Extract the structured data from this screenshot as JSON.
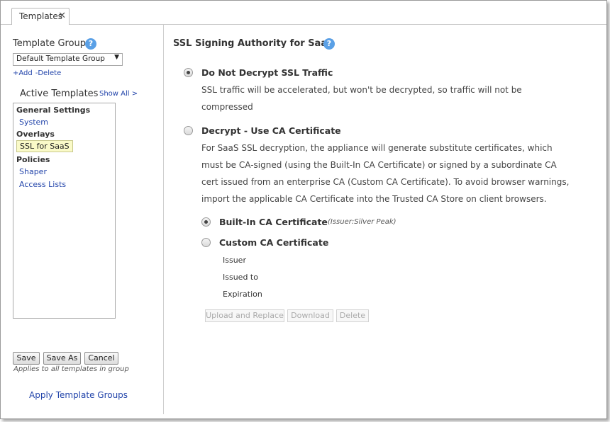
{
  "tab": {
    "title": "Templates",
    "close": "✕"
  },
  "sidebar": {
    "template_group_label": "Template Group",
    "help": "?",
    "group_select_value": "Default Template Group",
    "add_link": "+Add",
    "delete_link": "-Delete",
    "active_templates_label": "Active Templates",
    "show_all": "Show All >",
    "tree": {
      "general_settings": "General Settings",
      "system": "System",
      "overlays": "Overlays",
      "ssl_for_saas": "SSL for SaaS",
      "policies": "Policies",
      "shaper": "Shaper",
      "access_lists": "Access Lists"
    },
    "buttons": {
      "save": "Save",
      "save_as": "Save As",
      "cancel": "Cancel"
    },
    "applies_note": "Applies to all templates in group",
    "apply_groups": "Apply Template Groups"
  },
  "main": {
    "title": "SSL Signing Authority for SaaS",
    "help": "?",
    "option1": {
      "label": "Do Not Decrypt SSL Traffic",
      "selected": true,
      "desc_line1": "SSL traffic will be accelerated, but won't be decrypted, so traffic will not be",
      "desc_line2": "compressed"
    },
    "option2": {
      "label": "Decrypt - Use CA Certificate",
      "selected": false,
      "desc_line1": "For SaaS SSL decryption, the appliance will generate substitute certificates, which",
      "desc_line2": "must be CA-signed (using the Built-In CA Certificate) or signed by a subordinate CA",
      "desc_line3": "cert issued from an enterprise CA (Custom CA Certificate). To avoid browser warnings,",
      "desc_line4": "import the applicable CA Certificate into the Trusted CA Store on client browsers."
    },
    "builtin": {
      "label": "Built-In CA Certificate",
      "issuer_note": "(Issuer:Silver Peak)",
      "selected": true
    },
    "custom": {
      "label": "Custom CA Certificate",
      "selected": false,
      "issuer": "Issuer",
      "issued_to": "Issued to",
      "expiration": "Expiration"
    },
    "buttons": {
      "upload_replace": "Upload and Replace",
      "download": "Download",
      "delete": "Delete"
    }
  },
  "colors": {
    "link": "#2244aa",
    "help_icon": "#5aa0e6",
    "selected_item_bg": "#fafac8"
  }
}
